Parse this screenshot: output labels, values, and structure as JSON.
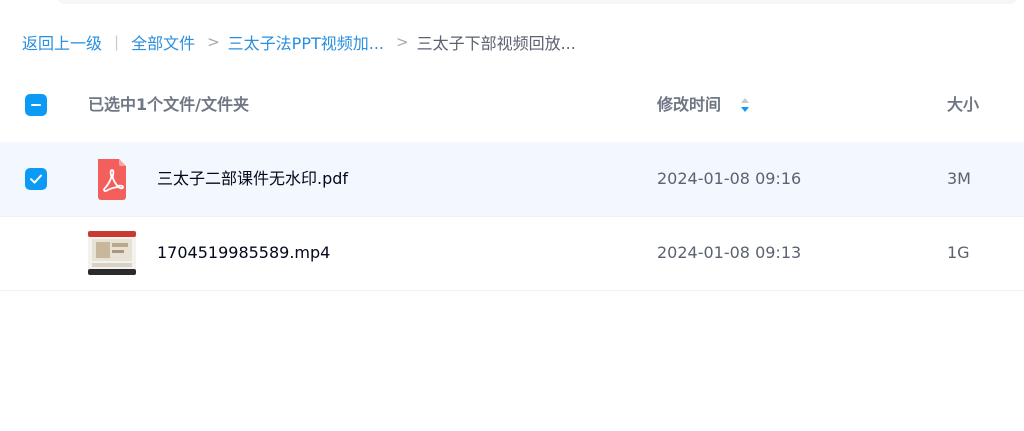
{
  "breadcrumb": {
    "back": "返回上一级",
    "divider": "|",
    "separator": ">",
    "items": [
      "全部文件",
      "三太子法PPT视频加...",
      "三太子下部视频回放..."
    ]
  },
  "header": {
    "selection_text": "已选中1个文件/文件夹",
    "modified_label": "修改时间",
    "size_label": "大小",
    "sort_icon": "sort-up-down-icon"
  },
  "files": [
    {
      "name": "三太子二部课件无水印.pdf",
      "modified": "2024-01-08 09:16",
      "size": "3M",
      "type_icon": "pdf-icon",
      "selected": true
    },
    {
      "name": "1704519985589.mp4",
      "modified": "2024-01-08 09:13",
      "size": "1G",
      "type_icon": "video-thumbnail",
      "selected": false
    }
  ],
  "colors": {
    "accent": "#0d9af5",
    "link": "#2a8fe0",
    "selected_row": "#f3f8fe",
    "pdf_red": "#f25f5c"
  }
}
